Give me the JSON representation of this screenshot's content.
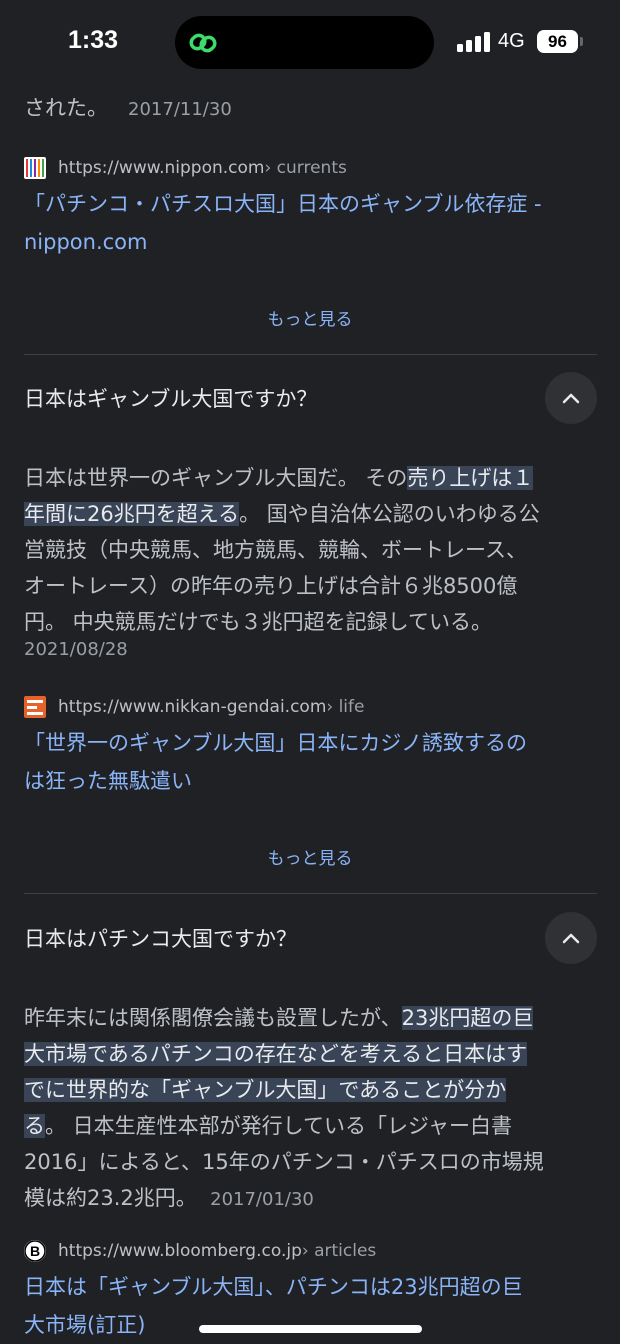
{
  "status_bar": {
    "time": "1:33",
    "network": "4G",
    "battery": "96"
  },
  "top_snippet": {
    "text": "された。",
    "date": "2017/11/30"
  },
  "result1": {
    "url": "https://www.nippon.com",
    "path": " › currents",
    "title_line1": "「パチンコ・パチスロ大国」日本のギャンブル依存症 -",
    "title_line2": "nippon.com"
  },
  "more_label": "もっと見る",
  "faq1": {
    "question": "日本はギャンブル大国ですか？",
    "line1_pre": "日本は世界一のギャンブル大国だ。 その",
    "line1_hl": "売り上げは１",
    "line2_hl": "年間に26兆円を超える",
    "line2_post": "。 国や自治体公認のいわゆる公",
    "line3": "営競技（中央競馬、地方競馬、競輪、ボートレース、",
    "line4": "オートレース）の昨年の売り上げは合計６兆8500億",
    "line5": "円。 中央競馬だけでも３兆円超を記録している。",
    "date": "2021/08/28",
    "url": "https://www.nikkan-gendai.com",
    "path": " › life",
    "title_line1": "「世界一のギャンブル大国」日本にカジノ誘致するの",
    "title_line2": "は狂った無駄遣い"
  },
  "faq2": {
    "question": "日本はパチンコ大国ですか？",
    "line1_pre": "昨年末には関係閣僚会議も設置したが、",
    "line1_hl": "23兆円超の巨",
    "line2_hl": "大市場であるパチンコの存在などを考えると日本はす",
    "line3_hl": "でに世界的な「ギャンブル大国」であることが分か",
    "line4_hl": "る",
    "line4_post": "。 日本生産性本部が発行している「レジャー白書",
    "line5": "2016」によると、15年のパチンコ・パチスロの市場規",
    "line6": "模は約23.2兆円。",
    "date": "2017/01/30",
    "url": "https://www.bloomberg.co.jp",
    "path": " › articles",
    "title_line1": "日本は「ギャンブル大国」、パチンコは23兆円超の巨",
    "title_line2": "大市場(訂正)"
  },
  "colors": {
    "background": "#202124",
    "link": "#8ab4f8",
    "highlight": "#394457",
    "text": "#bdc1c6"
  }
}
